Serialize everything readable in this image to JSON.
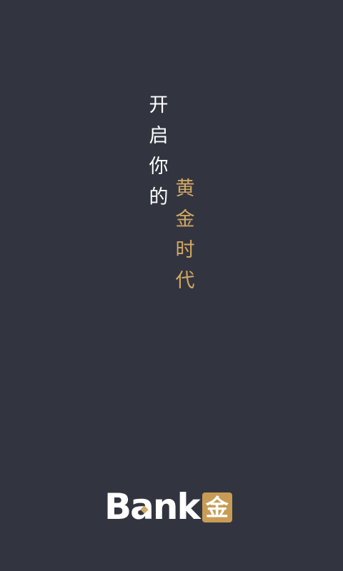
{
  "slogan": {
    "white_chars": [
      "开",
      "启",
      "你",
      "的"
    ],
    "gold_chars": [
      "黄",
      "金",
      "时",
      "代"
    ]
  },
  "logo": {
    "word": "Bank",
    "badge": "金"
  },
  "colors": {
    "background": "#323540",
    "text_white": "#ffffff",
    "gold": "#d2a862"
  }
}
